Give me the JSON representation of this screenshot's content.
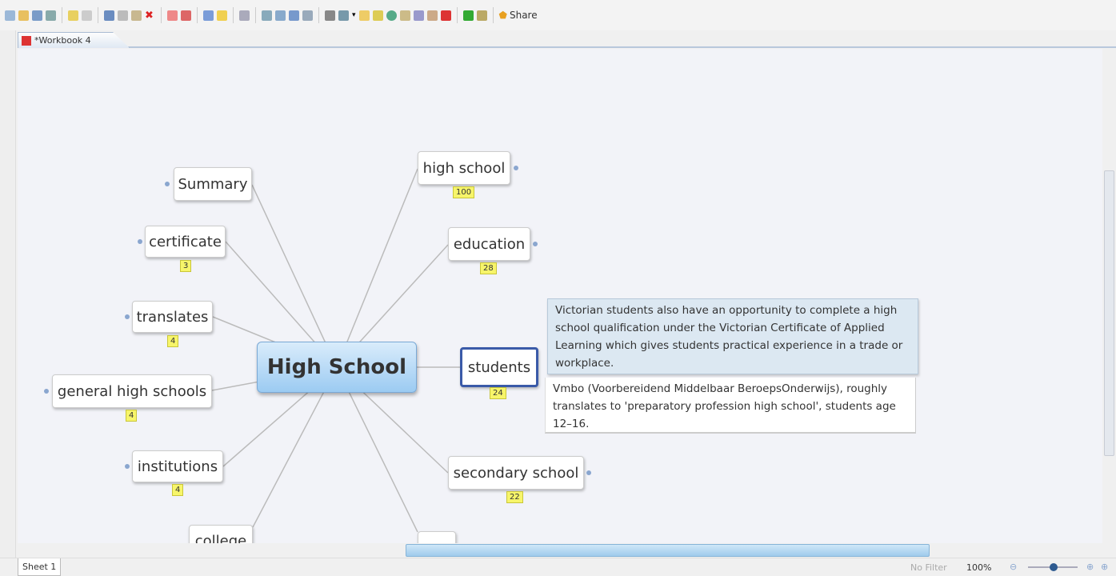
{
  "toolbar": {
    "share_label": "Share"
  },
  "tab": {
    "title": "*Workbook 4"
  },
  "map": {
    "central": "High School",
    "topics": [
      {
        "label": "Summary"
      },
      {
        "label": "certificate",
        "count": "3"
      },
      {
        "label": "translates",
        "count": "4"
      },
      {
        "label": "general high schools",
        "count": "4"
      },
      {
        "label": "institutions",
        "count": "4"
      },
      {
        "label": "college"
      },
      {
        "label": "high school",
        "count": "100"
      },
      {
        "label": "education",
        "count": "28"
      },
      {
        "label": "students",
        "count": "24"
      },
      {
        "label": "secondary school",
        "count": "22"
      }
    ],
    "notes": [
      "Victorian students also have an opportunity to complete a high school qualification under the Victorian Certificate of Applied Learning which gives students practical experience in a trade or workplace.",
      "Vmbo (Voorbereidend Middelbaar BeroepsOnderwijs), roughly translates to 'preparatory profession high school', students age 12–16."
    ]
  },
  "status": {
    "sheet": "Sheet 1",
    "filter": "No Filter",
    "zoom": "100%"
  },
  "colors": {
    "accent": "#9ccbf2",
    "badge": "#f7f56a",
    "selected": "#3a5aa8"
  }
}
